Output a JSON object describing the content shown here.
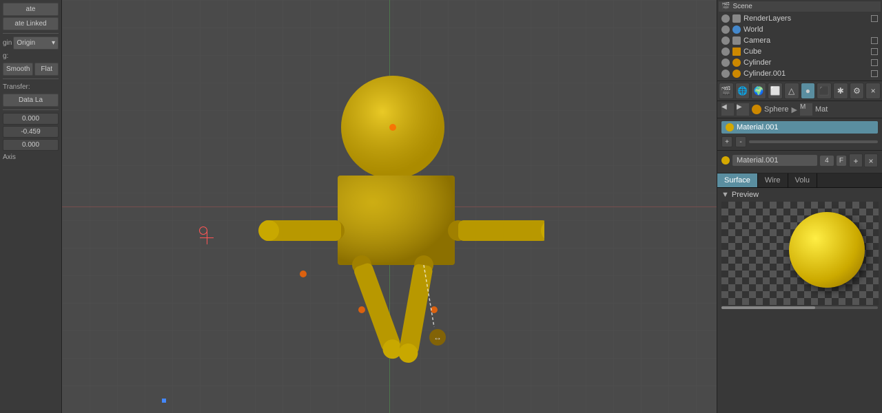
{
  "leftPanel": {
    "title": "ate",
    "buttons": [
      "ate",
      "ate Linked"
    ],
    "origin_label": "gin",
    "shading_label": "g:",
    "flat_label": "Flat",
    "transfer_label": "Transfer:",
    "data_label": "Data La",
    "nums": [
      {
        "label": "",
        "value": "0.000"
      },
      {
        "label": "",
        "value": "-0.459"
      },
      {
        "label": "",
        "value": "0.000"
      }
    ],
    "axis_label": "Axis"
  },
  "outliner": {
    "header": "Scene",
    "items": [
      {
        "name": "RenderLayers",
        "type": "renderlayers",
        "icon2": true
      },
      {
        "name": "World",
        "type": "world",
        "icon2": false
      },
      {
        "name": "Camera",
        "type": "camera",
        "icon2": true
      },
      {
        "name": "Cube",
        "type": "cube",
        "icon2": true
      },
      {
        "name": "Cylinder",
        "type": "sphere",
        "icon2": true
      },
      {
        "name": "Cylinder.001",
        "type": "sphere",
        "icon2": true
      }
    ]
  },
  "breadcrumb": {
    "items": [
      "Sphere",
      "Mat"
    ]
  },
  "materialSlot": {
    "name": "Material.001",
    "controls": [
      "+",
      "-",
      "↑",
      "↓"
    ]
  },
  "matProps": {
    "name": "Material.001",
    "num": "4",
    "flag": "F",
    "actions": [
      "+",
      "×"
    ]
  },
  "tabs": {
    "items": [
      "Surface",
      "Wire",
      "Volu"
    ],
    "active": "Surface"
  },
  "preview": {
    "label": "Preview"
  },
  "viewport": {
    "cursor_icon": "↔"
  }
}
